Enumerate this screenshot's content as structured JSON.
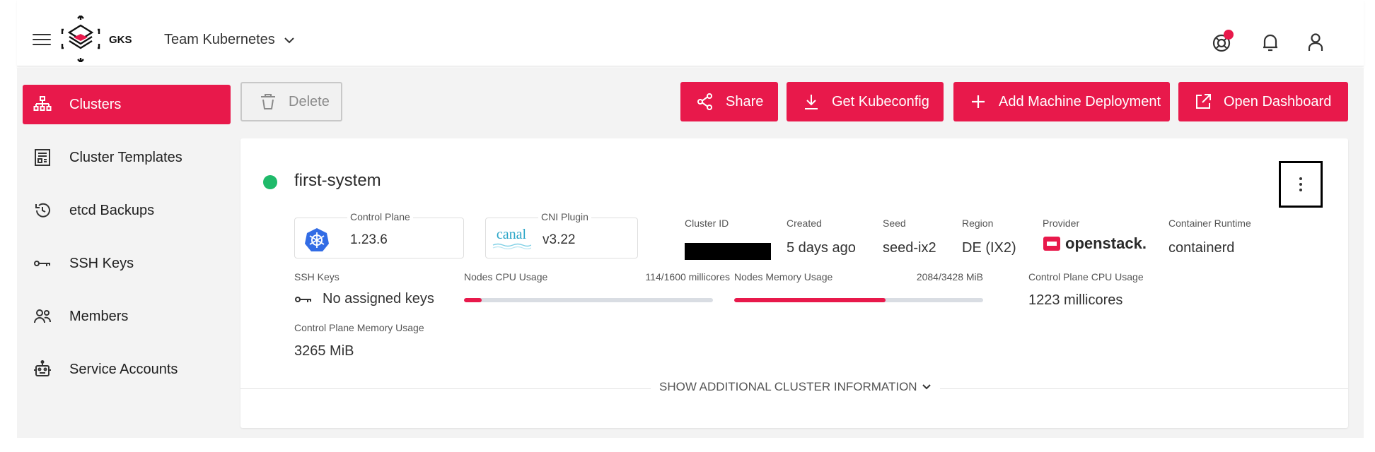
{
  "header": {
    "logo_text": "GKS",
    "project_name": "Team Kubernetes",
    "icons": [
      "menu-icon",
      "help-icon",
      "bell-icon",
      "user-icon"
    ]
  },
  "sidebar": {
    "items": [
      {
        "label": "Clusters",
        "icon": "sitemap-icon",
        "active": true
      },
      {
        "label": "Cluster Templates",
        "icon": "template-icon",
        "active": false
      },
      {
        "label": "etcd Backups",
        "icon": "history-icon",
        "active": false
      },
      {
        "label": "SSH Keys",
        "icon": "key-icon",
        "active": false
      },
      {
        "label": "Members",
        "icon": "members-icon",
        "active": false
      },
      {
        "label": "Service Accounts",
        "icon": "robot-icon",
        "active": false
      }
    ]
  },
  "toolbar": {
    "delete_label": "Delete",
    "share_label": "Share",
    "kubeconfig_label": "Get Kubeconfig",
    "add_md_label": "Add Machine Deployment",
    "dashboard_label": "Open Dashboard"
  },
  "cluster": {
    "name": "first-system",
    "status_color": "#1fba6a",
    "control_plane": {
      "label": "Control Plane",
      "value": "1.23.6"
    },
    "cni_plugin": {
      "label": "CNI Plugin",
      "value": "v3.22",
      "logo_text": "canal"
    },
    "cluster_id_label": "Cluster ID",
    "created": {
      "label": "Created",
      "value": "5 days ago"
    },
    "seed": {
      "label": "Seed",
      "value": "seed-ix2"
    },
    "region": {
      "label": "Region",
      "value": "DE (IX2)"
    },
    "provider": {
      "label": "Provider",
      "value": "openstack."
    },
    "runtime": {
      "label": "Container Runtime",
      "value": "containerd"
    },
    "ssh_keys": {
      "label": "SSH Keys",
      "value": "No assigned keys"
    },
    "nodes_cpu": {
      "label": "Nodes CPU Usage",
      "usage_text": "114/1600 millicores",
      "fraction": 0.07125
    },
    "nodes_mem": {
      "label": "Nodes Memory Usage",
      "usage_text": "2084/3428 MiB",
      "fraction": 0.608
    },
    "cp_cpu": {
      "label": "Control Plane CPU Usage",
      "value": "1223 millicores"
    },
    "cp_mem": {
      "label": "Control Plane Memory Usage",
      "value": "3265 MiB"
    },
    "show_more_label": "SHOW ADDITIONAL CLUSTER INFORMATION"
  },
  "colors": {
    "accent": "#e8194b",
    "status_ok": "#1fba6a"
  }
}
